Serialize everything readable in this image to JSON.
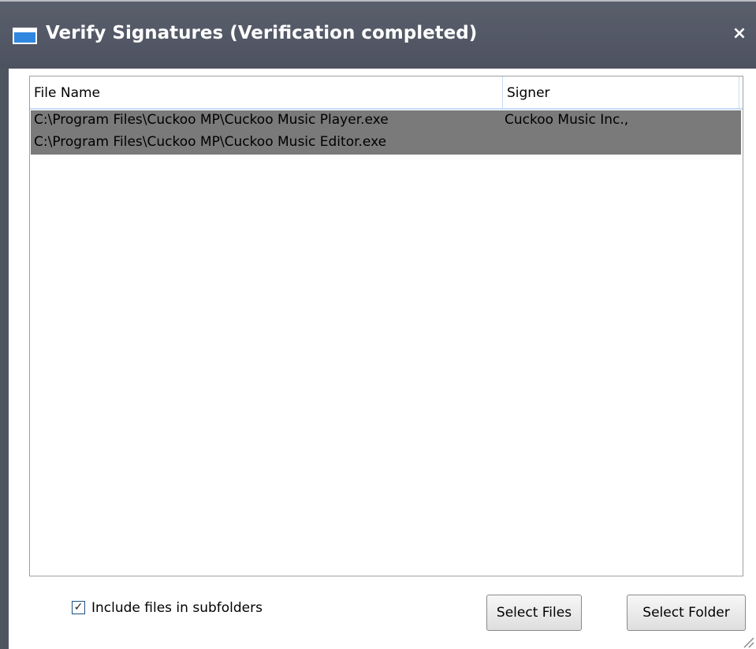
{
  "window": {
    "title": "Verify Signatures (Verification completed)",
    "close_glyph": "×"
  },
  "table": {
    "columns": [
      "File Name",
      "Signer"
    ],
    "rows": [
      {
        "file_name": "C:\\Program Files\\Cuckoo MP\\Cuckoo Music Player.exe",
        "signer": "Cuckoo Music Inc.,"
      },
      {
        "file_name": "C:\\Program Files\\Cuckoo MP\\Cuckoo Music Editor.exe",
        "signer": ""
      }
    ],
    "selected_row_color": "#7a7a7a"
  },
  "options": {
    "include_subfolders_label": "Include files in subfolders",
    "include_subfolders_checked": true,
    "check_glyph": "✓"
  },
  "buttons": {
    "select_files": "Select Files",
    "select_folder": "Select Folder"
  },
  "icons": {
    "title": "window-icon",
    "close": "close-icon",
    "resize": "resize-grip-icon"
  }
}
